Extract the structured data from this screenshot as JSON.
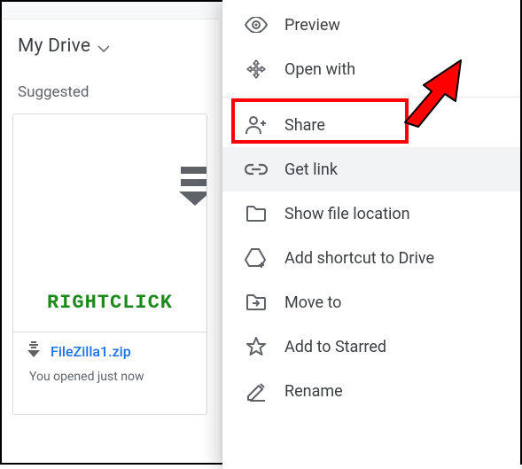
{
  "location": {
    "title": "My Drive"
  },
  "suggested": {
    "label": "Suggested"
  },
  "overlay": {
    "rightclick": "RIGHTCLICK"
  },
  "file": {
    "name": "FileZilla1.zip",
    "subtitle": "You opened just now"
  },
  "menu": {
    "preview": "Preview",
    "open_with": "Open with",
    "share": "Share",
    "get_link": "Get link",
    "show_location": "Show file location",
    "add_shortcut": "Add shortcut to Drive",
    "move_to": "Move to",
    "add_starred": "Add to Starred",
    "rename": "Rename"
  }
}
